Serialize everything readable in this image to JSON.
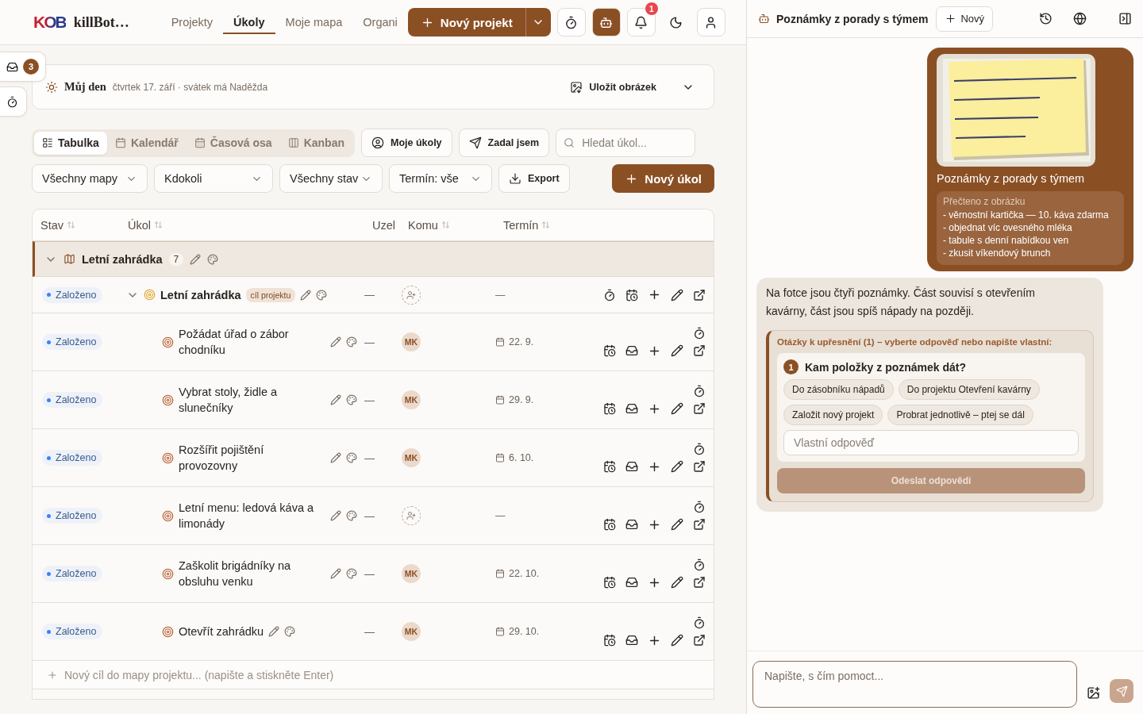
{
  "topbar": {
    "logo": "KOB",
    "brand": "killBot…",
    "nav": [
      {
        "label": "Projekty",
        "selected": false
      },
      {
        "label": "Úkoly",
        "selected": true
      },
      {
        "label": "Moje mapa",
        "selected": false
      },
      {
        "label": "Organi",
        "selected": false
      }
    ],
    "new_project": "Nový projekt",
    "notifications": "1"
  },
  "side_tab": {
    "inbox_count": "3"
  },
  "my_day": {
    "title": "Můj den",
    "subtitle": "čtvrtek 17. září · svátek má Naděžda",
    "save": "Uložit obrázek"
  },
  "view_tabs": [
    {
      "label": "Tabulka",
      "kind": "table",
      "selected": true
    },
    {
      "label": "Kalendář",
      "kind": "calendar",
      "selected": false
    },
    {
      "label": "Časová osa",
      "kind": "timeline",
      "selected": false
    },
    {
      "label": "Kanban",
      "kind": "kanban",
      "selected": false
    }
  ],
  "quick_filters": [
    {
      "label": "Moje úkoly",
      "kind": "mine"
    },
    {
      "label": "Zadal jsem",
      "kind": "assigned"
    }
  ],
  "search": {
    "placeholder": "Hledat úkol..."
  },
  "dropdowns": [
    "Všechny mapy",
    "Kdokoli",
    "Všechny stav",
    "Termín: vše"
  ],
  "export": "Export",
  "new_task": "Nový úkol",
  "table": {
    "columns": [
      {
        "label": "Stav",
        "sortable": true
      },
      {
        "label": "Úkol",
        "sortable": true
      },
      {
        "label": "Uzel",
        "sortable": false
      },
      {
        "label": "Komu",
        "sortable": true
      },
      {
        "label": "Termín",
        "sortable": true
      }
    ],
    "groups": [
      {
        "name": "Letní zahrádka",
        "count": "7",
        "expanded": true,
        "items": [
          {
            "status": "Založeno",
            "title": "Letní zahrádka",
            "tag": "cíl projektu",
            "node": "—",
            "due": "—",
            "scheduled": false,
            "expanded": true,
            "children": [
              {
                "status": "Založeno",
                "title": "Požádat úřad o zábor chodníku",
                "node": "—",
                "assignee": "MK",
                "due": "22. 9.",
                "scheduled": true
              },
              {
                "status": "Založeno",
                "title": "Vybrat stoly, židle a slunečníky",
                "node": "—",
                "assignee": "MK",
                "due": "29. 9.",
                "scheduled": true
              },
              {
                "status": "Založeno",
                "title": "Rozšířit pojištění provozovny",
                "node": "—",
                "assignee": "MK",
                "due": "6. 10.",
                "scheduled": true
              },
              {
                "status": "Založeno",
                "title": "Letní menu: ledová káva a limonády",
                "node": "—",
                "due": "—",
                "scheduled": false
              },
              {
                "status": "Založeno",
                "title": "Zaškolit brigádníky na obsluhu venku",
                "node": "—",
                "assignee": "MK",
                "due": "22. 10.",
                "scheduled": true
              },
              {
                "status": "Založeno",
                "title": "Otevřít zahrádku",
                "node": "—",
                "assignee": "MK",
                "due": "29. 10.",
                "scheduled": true
              }
            ]
          }
        ],
        "add_placeholder": "Nový cíl do mapy projektu... (napište a stiskněte Enter)"
      }
    ]
  },
  "chat": {
    "title": "Poznámky z porady s týmem",
    "new": "Nový",
    "messages": [
      {
        "kind": "user",
        "image": {
          "kind": "picture"
        },
        "caption": "Poznámky z porady s týmem",
        "ocr_label": "Přečteno z obrázku",
        "ocr_lines": [
          "- věrnostní kartička — 10. káva zdarma",
          "- objednat víc ovesného mléka",
          "- tabule s denní nabídkou ven",
          "- zkusit víkendový brunch"
        ]
      },
      {
        "kind": "assistant",
        "text": "Na fotce jsou čtyři poznámky. Část souvisí s otevřením kavárny, část jsou spíš nápady na později.",
        "questions": {
          "heading": "Otázky k upřesnění (1) – vyberte odpověď nebo napište vlastní:",
          "items": [
            {
              "number": "1",
              "text": "Kam položky z poznámek dát?",
              "options": [
                "Do zásobníku nápadů",
                "Do projektu Otevření kavárny",
                "Založit nový projekt",
                "Probrat jednotlivě – ptej se dál"
              ],
              "placeholder": "Vlastní odpověď"
            }
          ],
          "submit": "Odeslat odpovědi",
          "submit_disabled": true
        }
      }
    ],
    "composer": {
      "placeholder": "Napište, s čím pomoct..."
    }
  }
}
